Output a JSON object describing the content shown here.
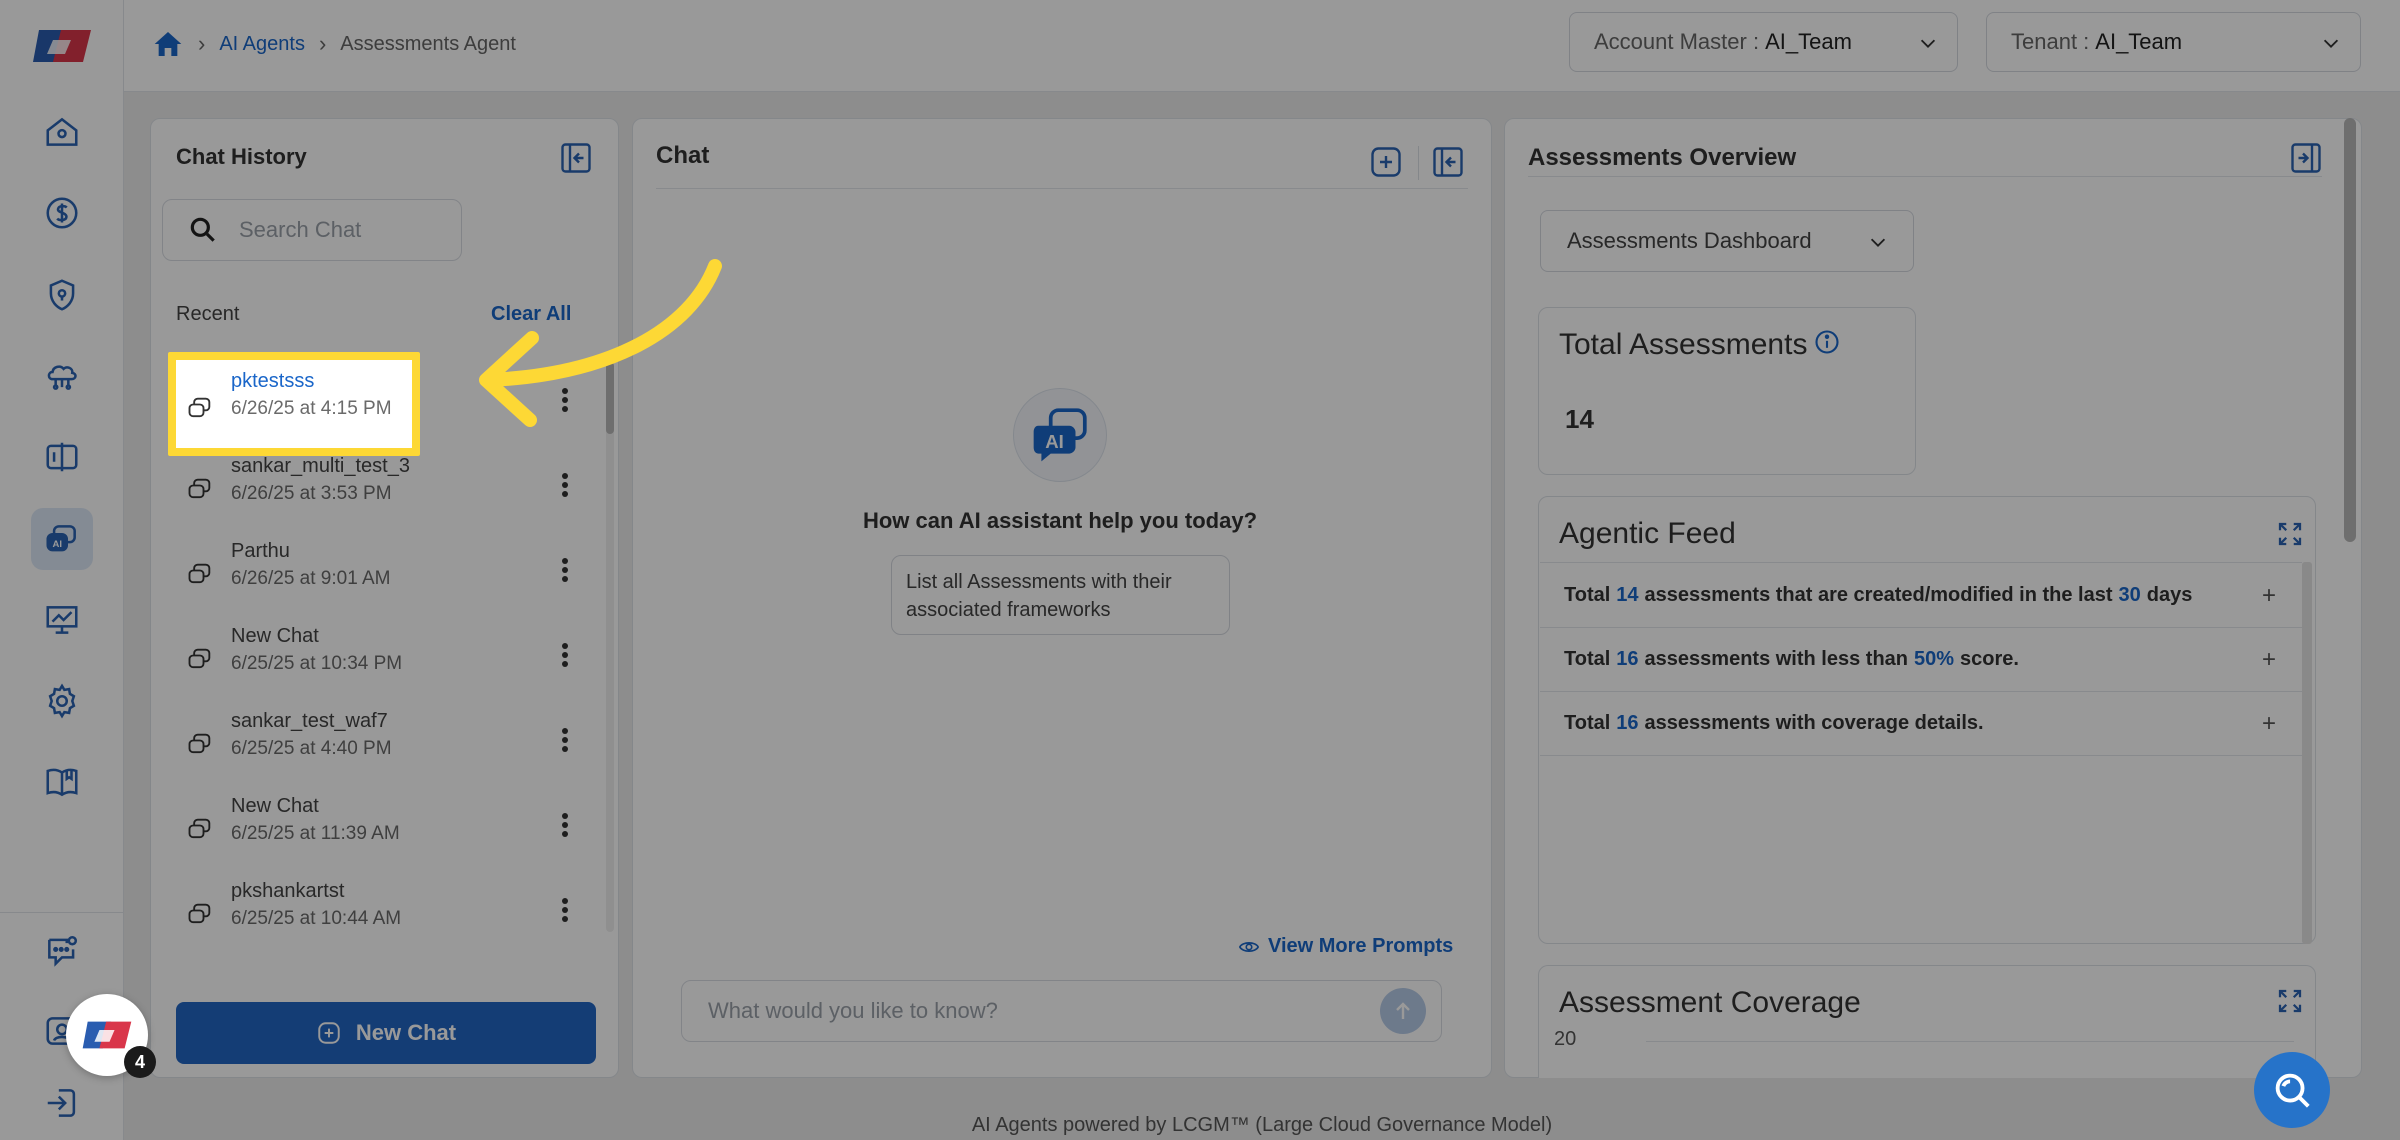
{
  "breadcrumb": {
    "root": "AI Agents",
    "current": "Assessments Agent"
  },
  "header": {
    "account_label": "Account Master :",
    "account_value": "AI_Team",
    "tenant_label": "Tenant :",
    "tenant_value": "AI_Team"
  },
  "sidebar": {
    "icons": [
      "home-icon",
      "dollar-icon",
      "shield-icon",
      "cloud-network-icon",
      "compare-icon",
      "ai-chat-icon",
      "presentation-icon",
      "gear-icon",
      "book-icon",
      "chat-settings-icon",
      "contact-icon",
      "logout-icon"
    ]
  },
  "history": {
    "title": "Chat History",
    "search_placeholder": "Search Chat",
    "recent_label": "Recent",
    "clear_all": "Clear All",
    "items": [
      {
        "title": "pktestsss",
        "time": "6/26/25 at 4:15 PM"
      },
      {
        "title": "sankar_multi_test_3",
        "time": "6/26/25 at 3:53 PM"
      },
      {
        "title": "Parthu",
        "time": "6/26/25 at 9:01 AM"
      },
      {
        "title": "New Chat",
        "time": "6/25/25 at 10:34 PM"
      },
      {
        "title": "sankar_test_waf7",
        "time": "6/25/25 at 4:40 PM"
      },
      {
        "title": "New Chat",
        "time": "6/25/25 at 11:39 AM"
      },
      {
        "title": "pkshankartst",
        "time": "6/25/25 at 10:44 AM"
      }
    ],
    "new_chat": "New Chat"
  },
  "chat": {
    "title": "Chat",
    "badge_text": "AI",
    "help_text": "How can AI assistant help you today?",
    "prompt": "List all Assessments with their associated frameworks",
    "view_more": "View More Prompts",
    "input_placeholder": "What would you like to know?"
  },
  "overview": {
    "title": "Assessments Overview",
    "dashboard_select": "Assessments Dashboard",
    "total_title": "Total Assessments",
    "total_value": "14",
    "feed_title": "Agentic Feed",
    "feed": [
      {
        "pre": "Total",
        "num": "14",
        "mid": "assessments that are created/modified in the last",
        "num2": "30",
        "post": "days"
      },
      {
        "pre": "Total",
        "num": "16",
        "mid": "assessments with less than",
        "num2": "50%",
        "post": "score."
      },
      {
        "pre": "Total",
        "num": "16",
        "mid": "assessments with coverage details.",
        "num2": "",
        "post": ""
      }
    ],
    "coverage_title": "Assessment Coverage",
    "coverage_tick": "20"
  },
  "footer": "AI Agents powered by LCGM™ (Large Cloud Governance Model)",
  "notification_count": "4",
  "colors": {
    "accent": "#2266c4",
    "highlight": "#fdd835",
    "link": "#1a66c9"
  }
}
